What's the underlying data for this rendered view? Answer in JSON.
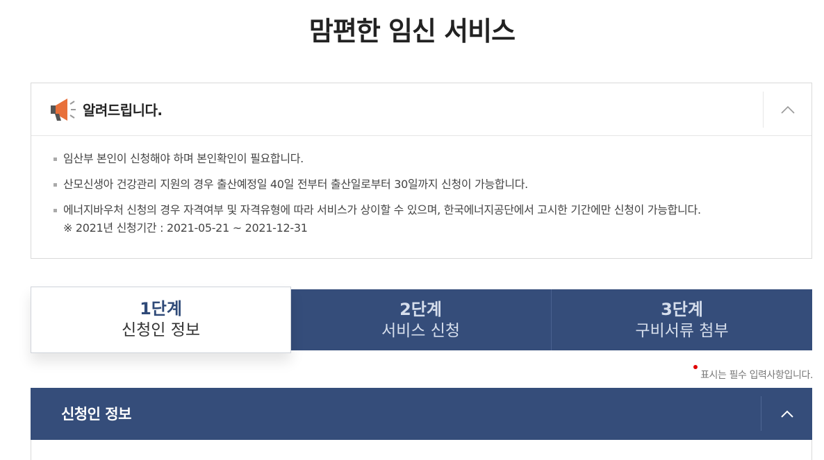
{
  "page": {
    "title": "맘편한 임신 서비스"
  },
  "notice": {
    "title": "알려드립니다.",
    "icon": "megaphone-icon",
    "toggle_icon": "chevron-up-icon",
    "items": [
      "임산부 본인이 신청해야 하며 본인확인이 필요합니다.",
      "산모신생아 건강관리 지원의 경우 출산예정일 40일 전부터 출산일로부터 30일까지 신청이 가능합니다.",
      "에너지바우처 신청의 경우 자격여부 및 자격유형에 따라 서비스가 상이할 수 있으며, 한국에너지공단에서 고시한 기간에만 신청이 가능합니다."
    ],
    "sub_note": "※ 2021년 신청기간 : 2021-05-21 ~ 2021-12-31"
  },
  "steps": [
    {
      "num": "1단계",
      "label": "신청인 정보",
      "active": true
    },
    {
      "num": "2단계",
      "label": "서비스 신청",
      "active": false
    },
    {
      "num": "3단계",
      "label": "구비서류 첨부",
      "active": false
    }
  ],
  "required_note": "표시는 필수 입력사항입니다.",
  "section": {
    "title": "신청인 정보",
    "toggle_icon": "chevron-up-icon"
  },
  "colors": {
    "primary": "#354d7a",
    "required": "#e00000"
  }
}
